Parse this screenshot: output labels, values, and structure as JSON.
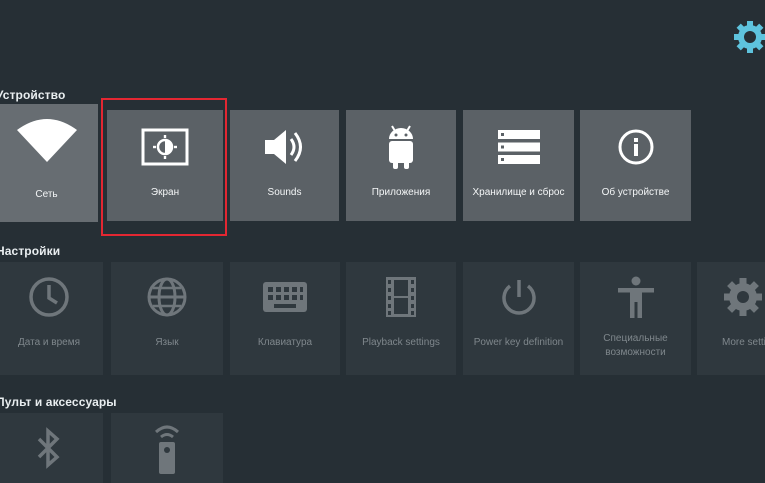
{
  "top_settings": {
    "icon": "gear-icon",
    "color": "#5ec3dd"
  },
  "sections": {
    "device": {
      "title": "Устройство"
    },
    "settings": {
      "title": "Настройки"
    },
    "remote": {
      "title": "Пульт и аксессуары"
    }
  },
  "device_tiles": [
    {
      "label": "Сеть",
      "icon": "wifi-icon"
    },
    {
      "label": "Экран",
      "icon": "display-icon"
    },
    {
      "label": "Sounds",
      "icon": "volume-icon"
    },
    {
      "label": "Приложения",
      "icon": "android-icon"
    },
    {
      "label": "Хранилище и сброс",
      "icon": "storage-icon"
    },
    {
      "label": "Об устройстве",
      "icon": "info-icon"
    }
  ],
  "settings_tiles": [
    {
      "label": "Дата и время",
      "icon": "clock-icon"
    },
    {
      "label": "Язык",
      "icon": "globe-icon"
    },
    {
      "label": "Клавиатура",
      "icon": "keyboard-icon"
    },
    {
      "label": "Playback settings",
      "icon": "film-icon"
    },
    {
      "label": "Power key definition",
      "icon": "power-icon"
    },
    {
      "label": "Специальные",
      "label2": "возможности",
      "icon": "accessibility-icon"
    },
    {
      "label": "More setti",
      "icon": "gear-icon"
    }
  ],
  "remote_tiles": [
    {
      "icon": "bluetooth-icon"
    },
    {
      "icon": "remote-icon"
    }
  ],
  "colors": {
    "highlight": "#e32732",
    "background": "#262f35"
  }
}
